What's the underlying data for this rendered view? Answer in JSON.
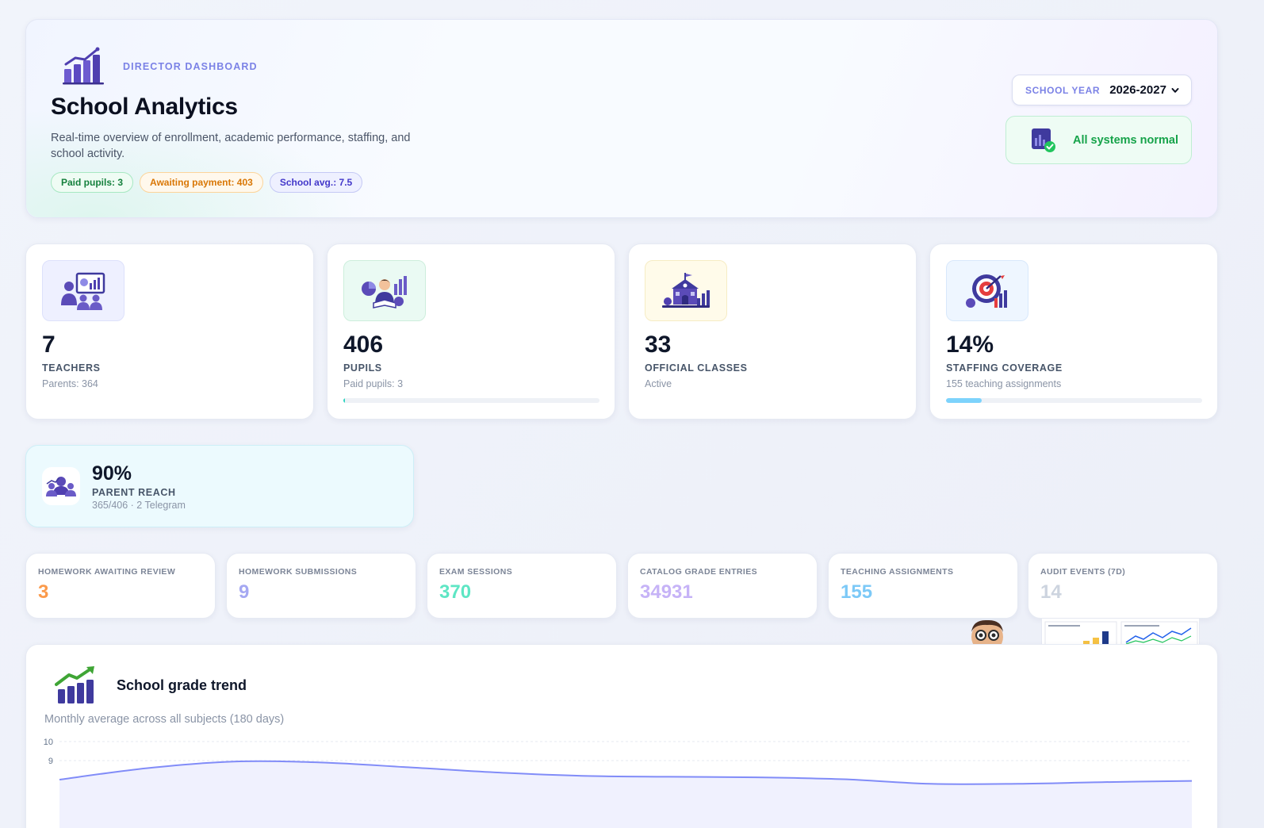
{
  "hero": {
    "eyebrow": "DIRECTOR DASHBOARD",
    "title": "School Analytics",
    "description": "Real-time overview of enrollment, academic performance, staffing, and school activity.",
    "chips": [
      {
        "text": "Paid pupils: 3",
        "tone": "green"
      },
      {
        "text": "Awaiting payment: 403",
        "tone": "orange"
      },
      {
        "text": "School avg.: 7.5",
        "tone": "indigo"
      }
    ],
    "school_year": {
      "label": "SCHOOL YEAR",
      "value": "2026-2027"
    },
    "status": "All systems normal"
  },
  "kpis": [
    {
      "value": "7",
      "label": "TEACHERS",
      "sub": "Parents: 364",
      "icon": "teacher-presentation-icon"
    },
    {
      "value": "406",
      "label": "PUPILS",
      "sub": "Paid pupils: 3",
      "icon": "pupil-reading-icon",
      "progress": 0.0074,
      "progress_color": "#2dd4bf"
    },
    {
      "value": "33",
      "label": "OFFICIAL CLASSES",
      "sub": "Active",
      "icon": "school-building-icon"
    },
    {
      "value": "14%",
      "label": "STAFFING COVERAGE",
      "sub": "155 teaching assignments",
      "icon": "target-icon",
      "progress": 0.14,
      "progress_color": "#7dd3fc"
    }
  ],
  "parent_reach": {
    "value": "90%",
    "label": "PARENT REACH",
    "sub": "365/406 · 2 Telegram",
    "icon": "parents-group-icon"
  },
  "stats": [
    {
      "label": "HOMEWORK AWAITING REVIEW",
      "value": "3",
      "color": "#fb9a4b"
    },
    {
      "label": "HOMEWORK SUBMISSIONS",
      "value": "9",
      "color": "#a5a8f2"
    },
    {
      "label": "EXAM SESSIONS",
      "value": "370",
      "color": "#5ee6c4"
    },
    {
      "label": "CATALOG GRADE ENTRIES",
      "value": "34931",
      "color": "#c6b3f7"
    },
    {
      "label": "TEACHING ASSIGNMENTS",
      "value": "155",
      "color": "#7cc9f7"
    },
    {
      "label": "AUDIT EVENTS (7D)",
      "value": "14",
      "color": "#cdd4df"
    }
  ],
  "chart": {
    "title": "School grade trend",
    "subtitle": "Monthly average across all subjects (180 days)",
    "icon": "growth-chart-icon"
  },
  "chart_data": {
    "type": "area",
    "y_ticks": [
      "10",
      "9"
    ],
    "ylim": [
      8,
      10
    ],
    "grid": true,
    "color": "#818cf8",
    "values": [
      8.0,
      8.6,
      8.95,
      8.9,
      8.65,
      8.38,
      8.2,
      8.15,
      8.12,
      8.02,
      7.78,
      7.78,
      7.87,
      7.93
    ]
  }
}
